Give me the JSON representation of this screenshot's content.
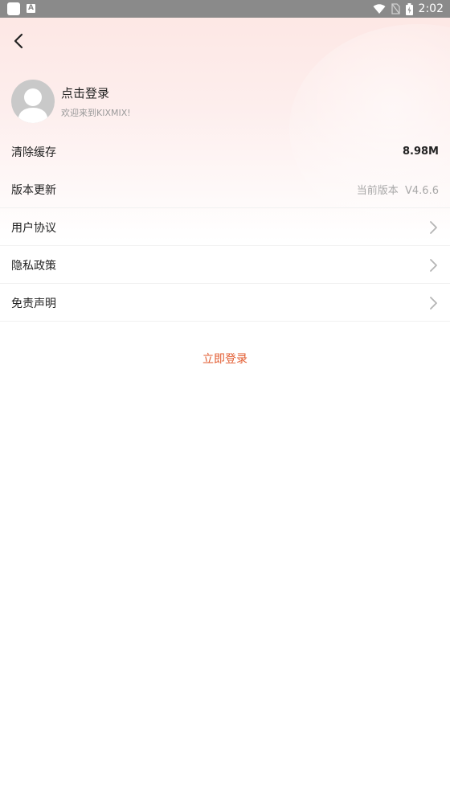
{
  "status_bar": {
    "time": "2:02",
    "notification_icon": "A"
  },
  "header": {
    "back_icon": "chevron-left-icon"
  },
  "profile": {
    "title": "点击登录",
    "subtitle": "欢迎来到KIXMIX!"
  },
  "menu": {
    "items": [
      {
        "label": "清除缓存",
        "value": "8.98M"
      },
      {
        "label": "版本更新",
        "value": "当前版本  V4.6.6"
      },
      {
        "label": "用户协议"
      },
      {
        "label": "隐私政策"
      },
      {
        "label": "免责声明"
      }
    ]
  },
  "login_button": "立即登录",
  "colors": {
    "accent": "#e25a2e",
    "header_gradient": "#fde6e3",
    "status_bar": "#8a8a8a"
  }
}
